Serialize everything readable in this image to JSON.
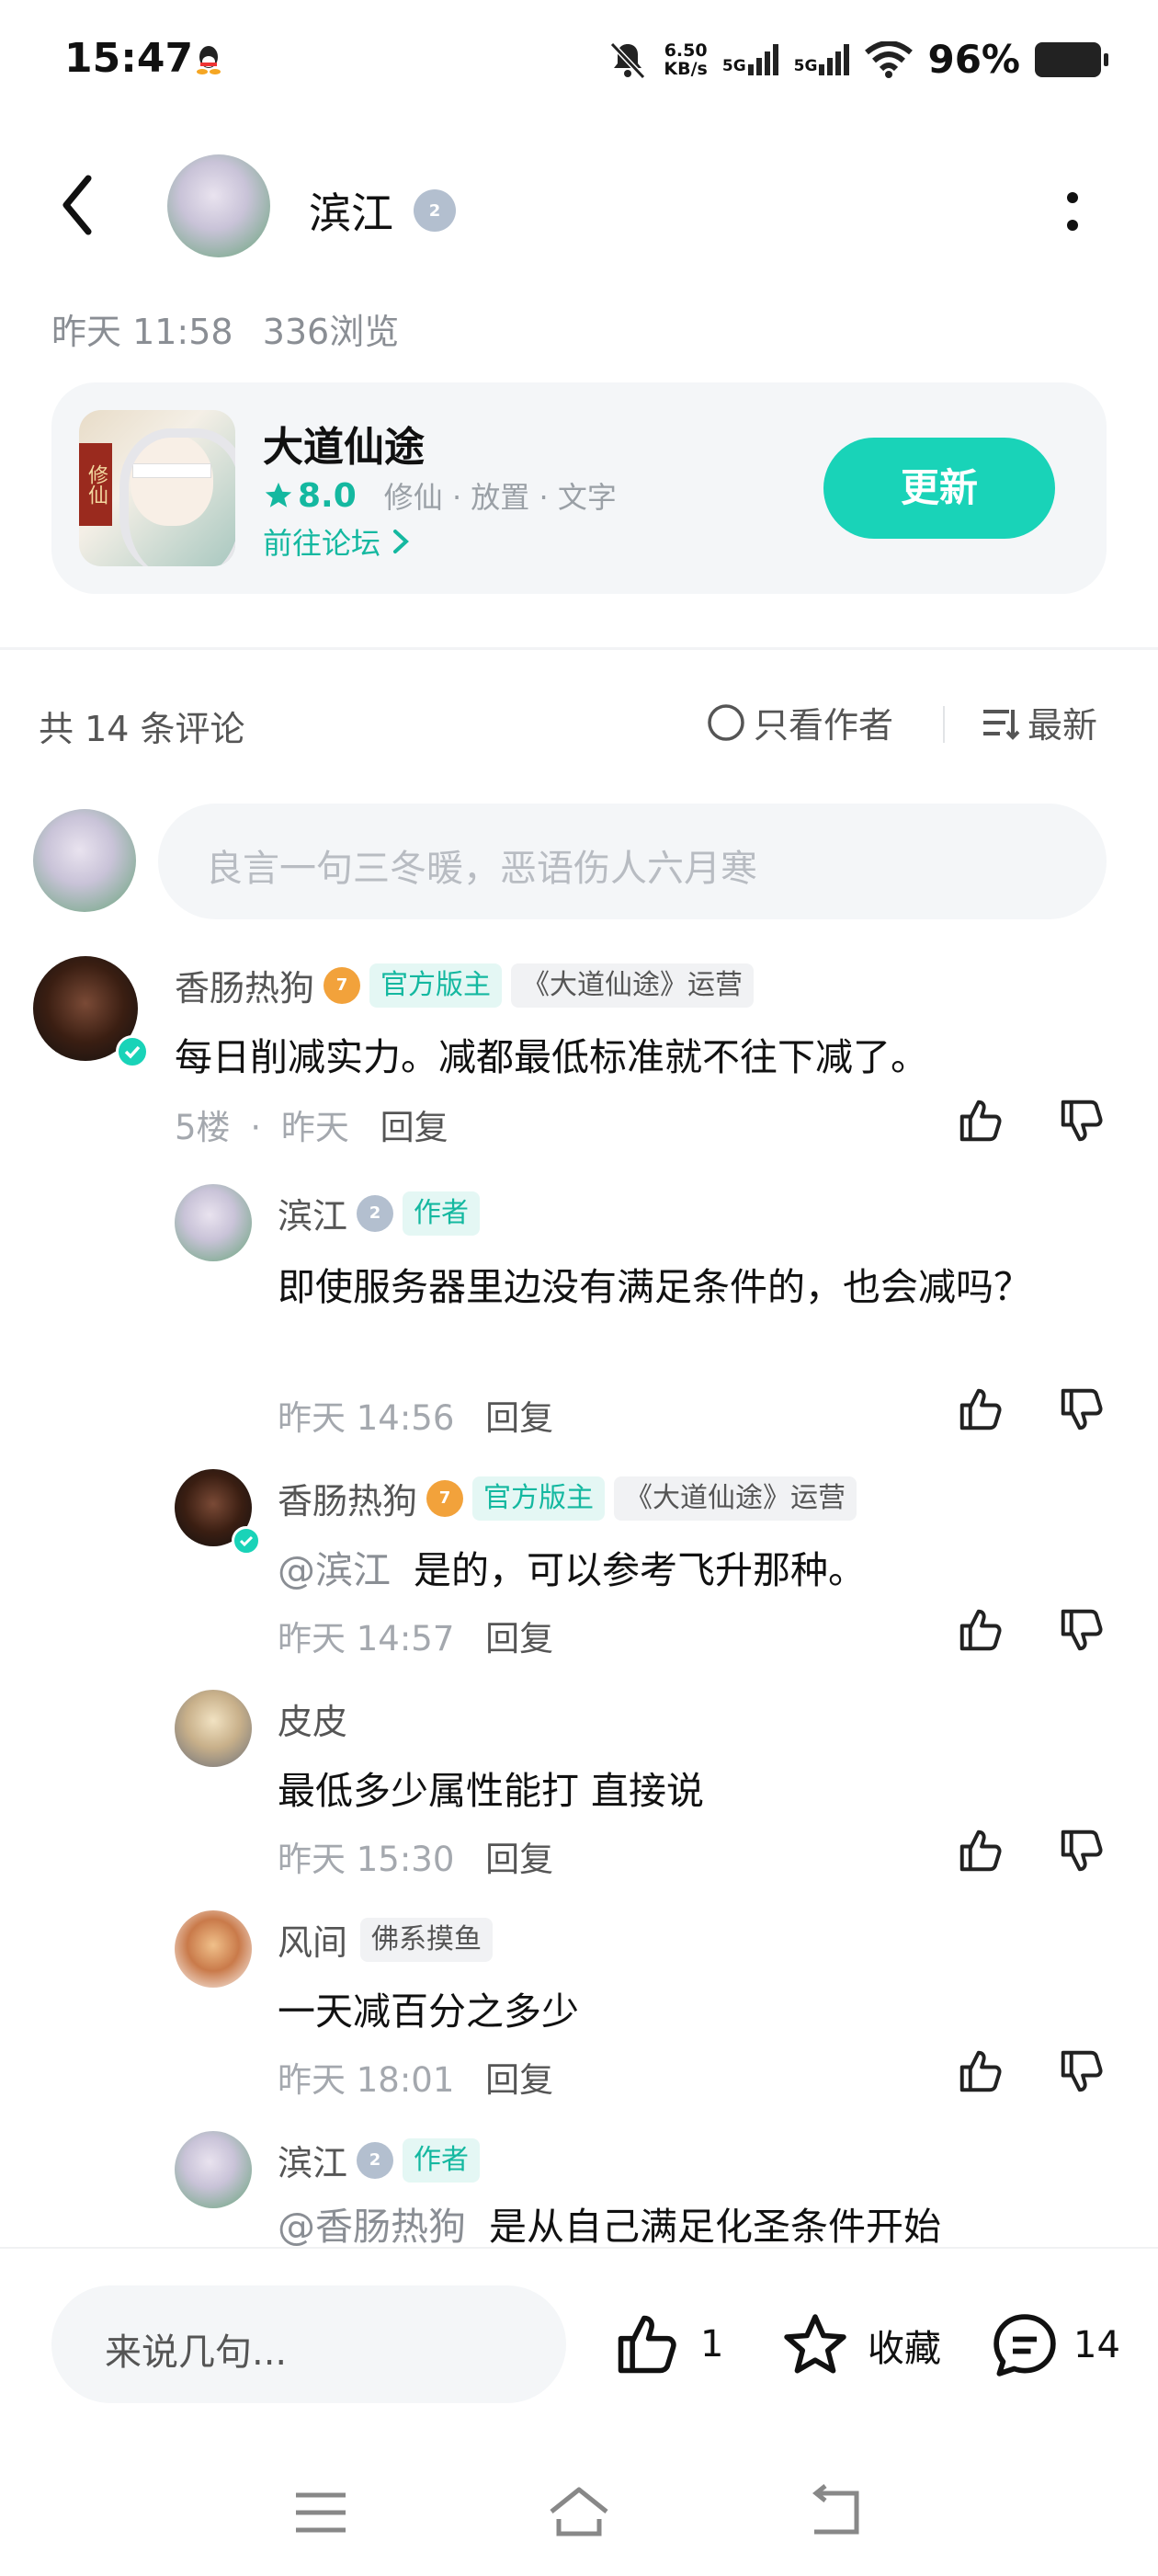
{
  "status": {
    "time": "15:47",
    "net_speed_top": "6.50",
    "net_speed_bottom": "KB/s",
    "sig1": "5G",
    "sig2": "5G",
    "battery": "96%"
  },
  "header": {
    "author_name": "滨江",
    "author_level": "2"
  },
  "post_meta": {
    "date": "昨天 11:58",
    "views": "336浏览"
  },
  "game_card": {
    "name": "大道仙途",
    "rating": "8.0",
    "tags": "修仙 · 放置 · 文字",
    "forum_link": "前往论坛",
    "update_button": "更新",
    "icon_text": "修仙"
  },
  "comments_bar": {
    "count_text": "共 14 条评论",
    "author_only": "只看作者",
    "sort": "最新"
  },
  "comment_input": {
    "placeholder": "良言一句三冬暖，恶语伤人六月寒"
  },
  "comments": [
    {
      "name": "香肠热狗",
      "level": "7",
      "tag1": "官方版主",
      "tag2": "《大道仙途》运营",
      "content": "每日削减实力。减都最低标准就不往下减了。",
      "floor": "5楼",
      "dot": "·",
      "time": "昨天",
      "reply": "回复"
    }
  ],
  "replies": [
    {
      "name": "滨江",
      "level": "2",
      "tag": "作者",
      "content": "即使服务器里边没有满足条件的，也会减吗？",
      "time": "昨天 14:56",
      "reply": "回复"
    },
    {
      "name": "香肠热狗",
      "level": "7",
      "tag1": "官方版主",
      "tag2": "《大道仙途》运营",
      "mention": "@滨江",
      "content": "是的，可以参考飞升那种。",
      "time": "昨天 14:57",
      "reply": "回复"
    },
    {
      "name": "皮皮",
      "content": "最低多少属性能打 直接说",
      "time": "昨天 15:30",
      "reply": "回复"
    },
    {
      "name": "风间",
      "tag": "佛系摸鱼",
      "content": "一天减百分之多少",
      "time": "昨天 18:01",
      "reply": "回复"
    },
    {
      "name": "滨江",
      "level": "2",
      "tag": "作者",
      "mention": "@香肠热狗",
      "content": "是从自己满足化圣条件开始"
    }
  ],
  "bottom_bar": {
    "input_placeholder": "来说几句...",
    "like_count": "1",
    "favorite_label": "收藏",
    "comment_count": "14"
  },
  "colors": {
    "accent": "#19d3b8",
    "accent_text": "#14b8a0",
    "card_bg": "#f4f6f8"
  }
}
